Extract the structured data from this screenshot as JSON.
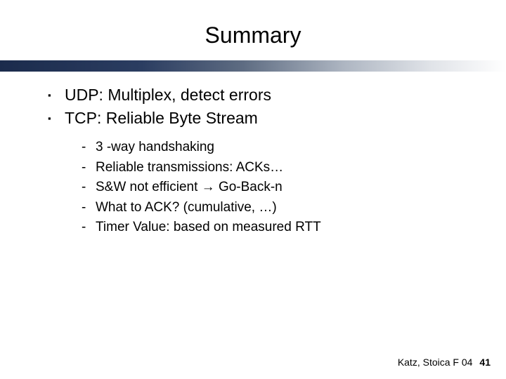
{
  "title": "Summary",
  "bullets": {
    "main": [
      {
        "text": "UDP: Multiplex, detect errors"
      },
      {
        "text": "TCP: Reliable Byte Stream"
      }
    ],
    "sub": [
      {
        "text": "3 -way handshaking"
      },
      {
        "text": "Reliable transmissions: ACKs…"
      },
      {
        "text": "S&W not efficient → Go-Back-n"
      },
      {
        "text": "What to ACK?  (cumulative, …)"
      },
      {
        "text": "Timer Value: based on measured RTT"
      }
    ]
  },
  "markers": {
    "square": "▪",
    "dash": "-"
  },
  "footer": {
    "credit": "Katz, Stoica F 04",
    "page": "41"
  }
}
